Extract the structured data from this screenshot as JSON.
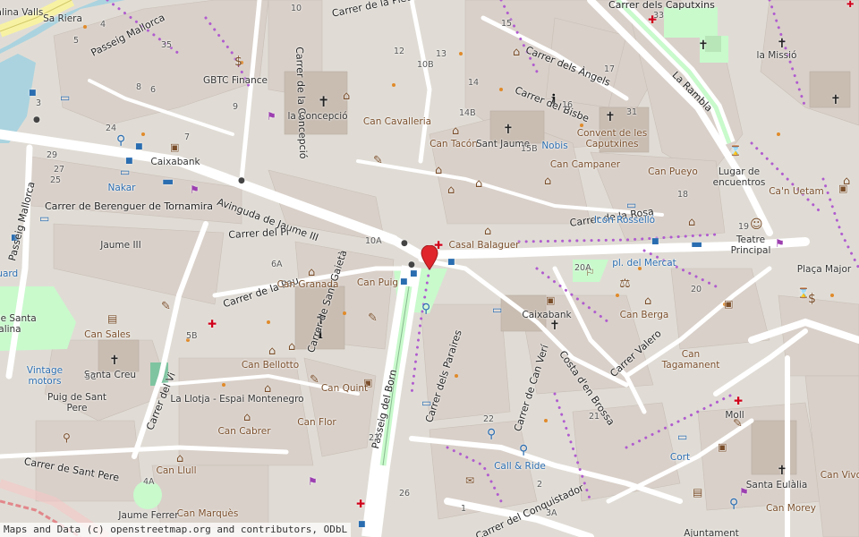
{
  "map": {
    "attribution": {
      "text": "Maps and Data (c) openstreetmap.org and contributors, ODbL",
      "link_text": "openstreetmap.org"
    },
    "marker": {
      "name": "location-pin",
      "color": "#e0262c"
    },
    "colors": {
      "background": "#e0dcd5",
      "building": "#d9d0c9",
      "road": "#ffffff",
      "primary_road": "#fcd6a4",
      "park": "#c8facc",
      "water": "#aad3df",
      "church": "#333333",
      "poi": "#7a4e2a",
      "bus_stop": "#2a6db0",
      "pharmacy": "#d0021b",
      "walkway_dots": "#b05ccf"
    },
    "streets": [
      "Passeig Mallorca",
      "Carrer de Berenguer de Tornamira",
      "Avinguda de Jaume III",
      "Carrer del Pi",
      "Carrer de la Pau",
      "Carrer de Sant Gaietà",
      "Passeig del Born",
      "Carrer dels Paraires",
      "Carrer de Can Verí",
      "Costa d'en Brossa",
      "Carrer Valero",
      "Carrer del Conquistador",
      "Carrer de la Rosa",
      "Carrer del Bisbe",
      "Carrer dels Àngels",
      "La Rambla",
      "Carrer del Vi",
      "Carrer de Sant Pere",
      "Passeig Mallorca",
      "Carrer de la Concepció",
      "Carrer de la Pietat",
      "Carrer dels Caputxins"
    ],
    "places": [
      "Jaume III",
      "la Concepció",
      "Can Cavalleria",
      "Can Tacón",
      "Sant Jaume",
      "Nobis",
      "Convent de les Caputxines",
      "Can Campaner",
      "Can Pueyo",
      "Casal Balaguer",
      "Icon Rosselló",
      "pl. del Mercat",
      "Teatre Principal",
      "Plaça Major",
      "Ca'n Uetam",
      "Lugar de encuentros",
      "la Missió",
      "Can Granada",
      "Can Puig",
      "Caixabank",
      "Can Berga",
      "Can Tagamanent",
      "Can Sales",
      "Santa Creu",
      "Can Bellotto",
      "Can Quint",
      "Can Flor",
      "Can Cabrer",
      "La Llotja - Espai Montenegro",
      "Puig de Sant Pere",
      "Can Llull",
      "Can Marquès",
      "Jaume Ferrer",
      "Moll",
      "Call & Ride",
      "Cort",
      "Santa Eulàlia",
      "Can Vivot",
      "Can Morey",
      "Ajuntament",
      "Vintage motors",
      "Nakar",
      "GBTC Finance",
      "Caixabank",
      "Catalina Valls",
      "Sa Riera",
      "Porta de Santa Catalina",
      "Baluard"
    ],
    "house_numbers": [
      "29",
      "27",
      "25",
      "24",
      "3",
      "4",
      "5",
      "6",
      "7",
      "8",
      "9",
      "10",
      "12",
      "13",
      "14",
      "15",
      "16",
      "17",
      "18",
      "19",
      "20",
      "21",
      "22",
      "23",
      "26",
      "2",
      "1",
      "3A",
      "4A",
      "5C",
      "5B",
      "6A",
      "10A",
      "10B",
      "14B",
      "15B",
      "20A",
      "31",
      "33",
      "35"
    ]
  }
}
